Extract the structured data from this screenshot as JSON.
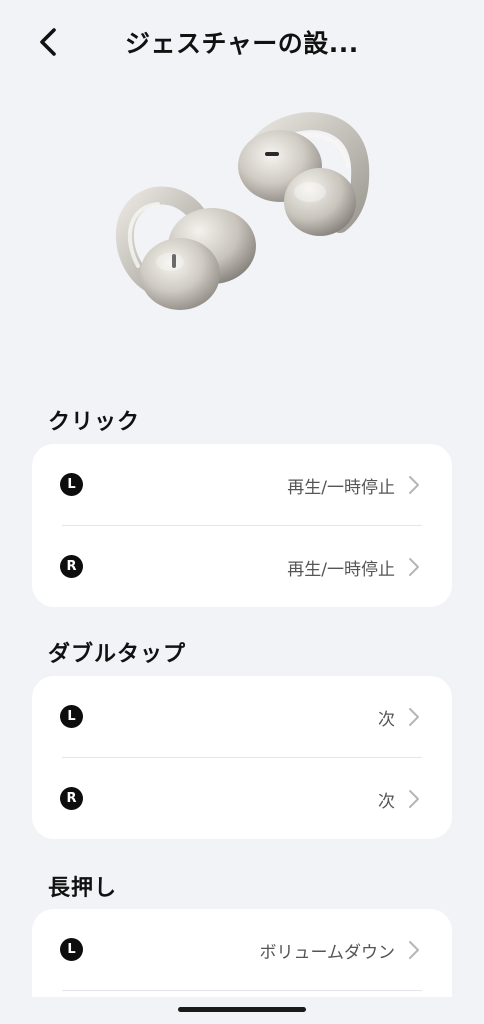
{
  "header": {
    "title": "ジェスチャーの設..."
  },
  "sections": [
    {
      "title": "クリック",
      "rows": [
        {
          "side": "L",
          "value": "再生/一時停止"
        },
        {
          "side": "R",
          "value": "再生/一時停止"
        }
      ]
    },
    {
      "title": "ダブルタップ",
      "rows": [
        {
          "side": "L",
          "value": "次"
        },
        {
          "side": "R",
          "value": "次"
        }
      ]
    },
    {
      "title": "長押し",
      "rows": [
        {
          "side": "L",
          "value": "ボリュームダウン"
        }
      ]
    }
  ],
  "icons": {
    "back": "chevron-left-icon",
    "row_arrow": "chevron-right-icon"
  },
  "colors": {
    "background": "#f2f3f7",
    "card": "#ffffff",
    "badge": "#0d0d0d",
    "value_text": "#555555",
    "chevron": "#b5b5bb"
  }
}
